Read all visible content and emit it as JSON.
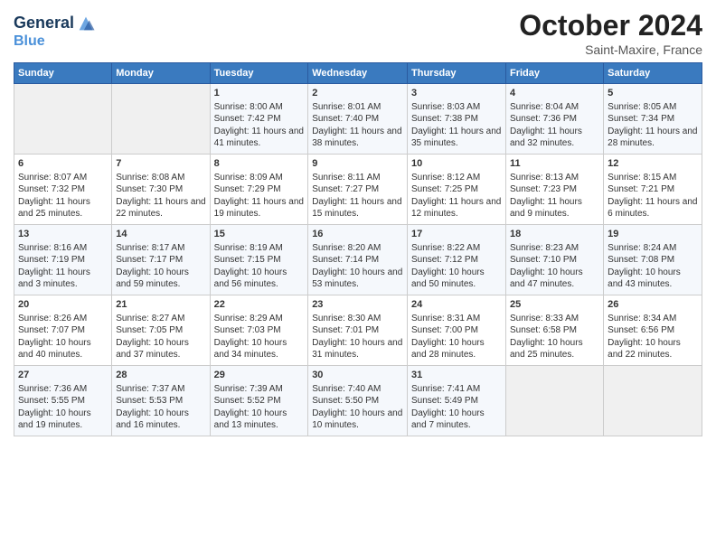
{
  "header": {
    "logo_line1": "General",
    "logo_line2": "Blue",
    "month": "October 2024",
    "location": "Saint-Maxire, France"
  },
  "days_of_week": [
    "Sunday",
    "Monday",
    "Tuesday",
    "Wednesday",
    "Thursday",
    "Friday",
    "Saturday"
  ],
  "weeks": [
    [
      {
        "day": "",
        "info": ""
      },
      {
        "day": "",
        "info": ""
      },
      {
        "day": "1",
        "info": "Sunrise: 8:00 AM\nSunset: 7:42 PM\nDaylight: 11 hours and 41 minutes."
      },
      {
        "day": "2",
        "info": "Sunrise: 8:01 AM\nSunset: 7:40 PM\nDaylight: 11 hours and 38 minutes."
      },
      {
        "day": "3",
        "info": "Sunrise: 8:03 AM\nSunset: 7:38 PM\nDaylight: 11 hours and 35 minutes."
      },
      {
        "day": "4",
        "info": "Sunrise: 8:04 AM\nSunset: 7:36 PM\nDaylight: 11 hours and 32 minutes."
      },
      {
        "day": "5",
        "info": "Sunrise: 8:05 AM\nSunset: 7:34 PM\nDaylight: 11 hours and 28 minutes."
      }
    ],
    [
      {
        "day": "6",
        "info": "Sunrise: 8:07 AM\nSunset: 7:32 PM\nDaylight: 11 hours and 25 minutes."
      },
      {
        "day": "7",
        "info": "Sunrise: 8:08 AM\nSunset: 7:30 PM\nDaylight: 11 hours and 22 minutes."
      },
      {
        "day": "8",
        "info": "Sunrise: 8:09 AM\nSunset: 7:29 PM\nDaylight: 11 hours and 19 minutes."
      },
      {
        "day": "9",
        "info": "Sunrise: 8:11 AM\nSunset: 7:27 PM\nDaylight: 11 hours and 15 minutes."
      },
      {
        "day": "10",
        "info": "Sunrise: 8:12 AM\nSunset: 7:25 PM\nDaylight: 11 hours and 12 minutes."
      },
      {
        "day": "11",
        "info": "Sunrise: 8:13 AM\nSunset: 7:23 PM\nDaylight: 11 hours and 9 minutes."
      },
      {
        "day": "12",
        "info": "Sunrise: 8:15 AM\nSunset: 7:21 PM\nDaylight: 11 hours and 6 minutes."
      }
    ],
    [
      {
        "day": "13",
        "info": "Sunrise: 8:16 AM\nSunset: 7:19 PM\nDaylight: 11 hours and 3 minutes."
      },
      {
        "day": "14",
        "info": "Sunrise: 8:17 AM\nSunset: 7:17 PM\nDaylight: 10 hours and 59 minutes."
      },
      {
        "day": "15",
        "info": "Sunrise: 8:19 AM\nSunset: 7:15 PM\nDaylight: 10 hours and 56 minutes."
      },
      {
        "day": "16",
        "info": "Sunrise: 8:20 AM\nSunset: 7:14 PM\nDaylight: 10 hours and 53 minutes."
      },
      {
        "day": "17",
        "info": "Sunrise: 8:22 AM\nSunset: 7:12 PM\nDaylight: 10 hours and 50 minutes."
      },
      {
        "day": "18",
        "info": "Sunrise: 8:23 AM\nSunset: 7:10 PM\nDaylight: 10 hours and 47 minutes."
      },
      {
        "day": "19",
        "info": "Sunrise: 8:24 AM\nSunset: 7:08 PM\nDaylight: 10 hours and 43 minutes."
      }
    ],
    [
      {
        "day": "20",
        "info": "Sunrise: 8:26 AM\nSunset: 7:07 PM\nDaylight: 10 hours and 40 minutes."
      },
      {
        "day": "21",
        "info": "Sunrise: 8:27 AM\nSunset: 7:05 PM\nDaylight: 10 hours and 37 minutes."
      },
      {
        "day": "22",
        "info": "Sunrise: 8:29 AM\nSunset: 7:03 PM\nDaylight: 10 hours and 34 minutes."
      },
      {
        "day": "23",
        "info": "Sunrise: 8:30 AM\nSunset: 7:01 PM\nDaylight: 10 hours and 31 minutes."
      },
      {
        "day": "24",
        "info": "Sunrise: 8:31 AM\nSunset: 7:00 PM\nDaylight: 10 hours and 28 minutes."
      },
      {
        "day": "25",
        "info": "Sunrise: 8:33 AM\nSunset: 6:58 PM\nDaylight: 10 hours and 25 minutes."
      },
      {
        "day": "26",
        "info": "Sunrise: 8:34 AM\nSunset: 6:56 PM\nDaylight: 10 hours and 22 minutes."
      }
    ],
    [
      {
        "day": "27",
        "info": "Sunrise: 7:36 AM\nSunset: 5:55 PM\nDaylight: 10 hours and 19 minutes."
      },
      {
        "day": "28",
        "info": "Sunrise: 7:37 AM\nSunset: 5:53 PM\nDaylight: 10 hours and 16 minutes."
      },
      {
        "day": "29",
        "info": "Sunrise: 7:39 AM\nSunset: 5:52 PM\nDaylight: 10 hours and 13 minutes."
      },
      {
        "day": "30",
        "info": "Sunrise: 7:40 AM\nSunset: 5:50 PM\nDaylight: 10 hours and 10 minutes."
      },
      {
        "day": "31",
        "info": "Sunrise: 7:41 AM\nSunset: 5:49 PM\nDaylight: 10 hours and 7 minutes."
      },
      {
        "day": "",
        "info": ""
      },
      {
        "day": "",
        "info": ""
      }
    ]
  ]
}
